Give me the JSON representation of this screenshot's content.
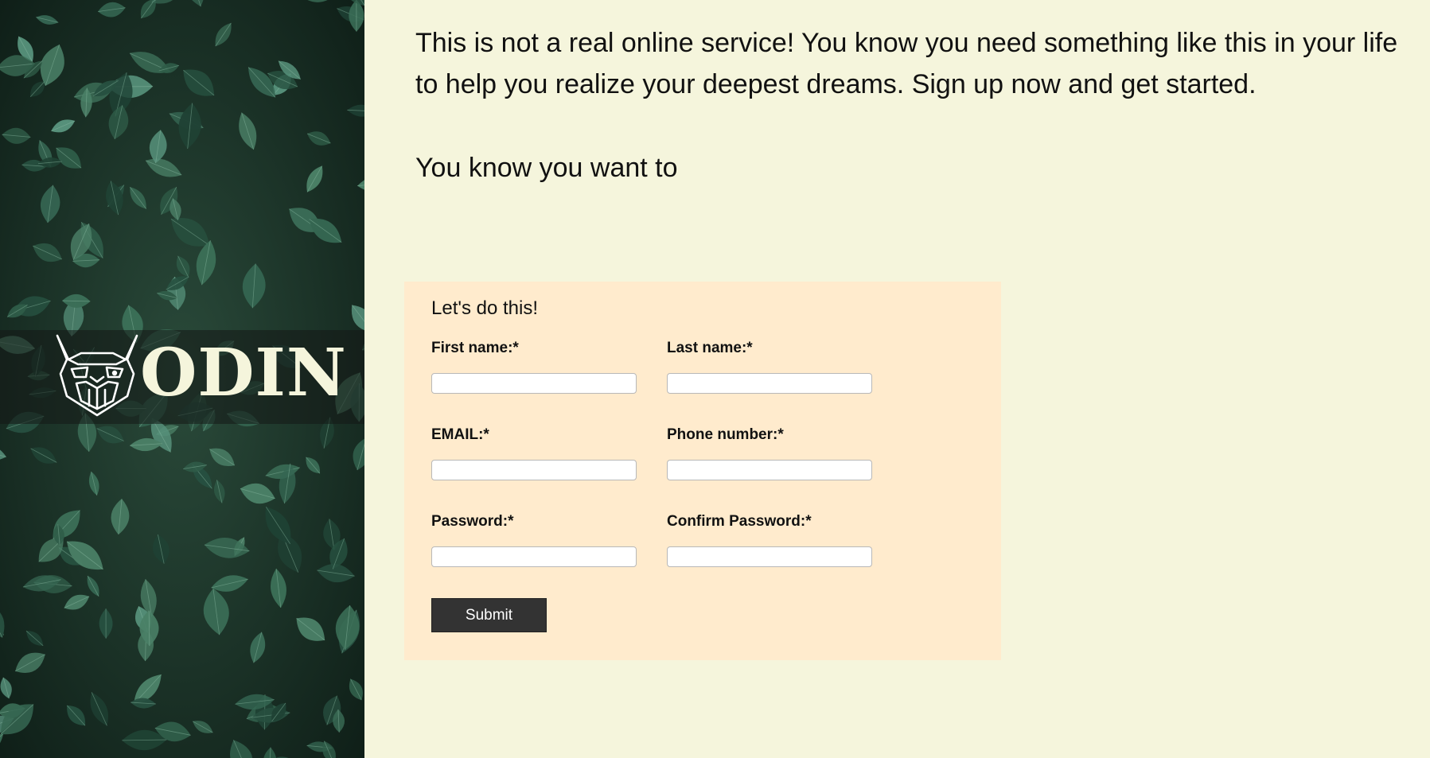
{
  "brand": {
    "name": "ODIN",
    "logo_icon": "odin-viking-head-icon",
    "background_image": "green-leaves-photo"
  },
  "intro": {
    "paragraph_1": "This is not a real online service! You know you need something like this in your life to help you realize your deepest dreams. Sign up now and get started.",
    "paragraph_2": "You know you want to"
  },
  "form": {
    "title": "Let's do this!",
    "fields": {
      "first_name": {
        "label": "First name:*",
        "value": ""
      },
      "last_name": {
        "label": "Last name:*",
        "value": ""
      },
      "email": {
        "label": "EMAIL:*",
        "value": ""
      },
      "phone": {
        "label": "Phone number:*",
        "value": ""
      },
      "password": {
        "label": "Password:*",
        "value": ""
      },
      "confirm_password": {
        "label": "Confirm Password:*",
        "value": ""
      }
    },
    "submit_label": "Submit"
  },
  "colors": {
    "page_background": "#f5f5dc",
    "form_background": "#ffebcd",
    "button_background": "#333333",
    "logo_text": "#f5f5dc"
  }
}
